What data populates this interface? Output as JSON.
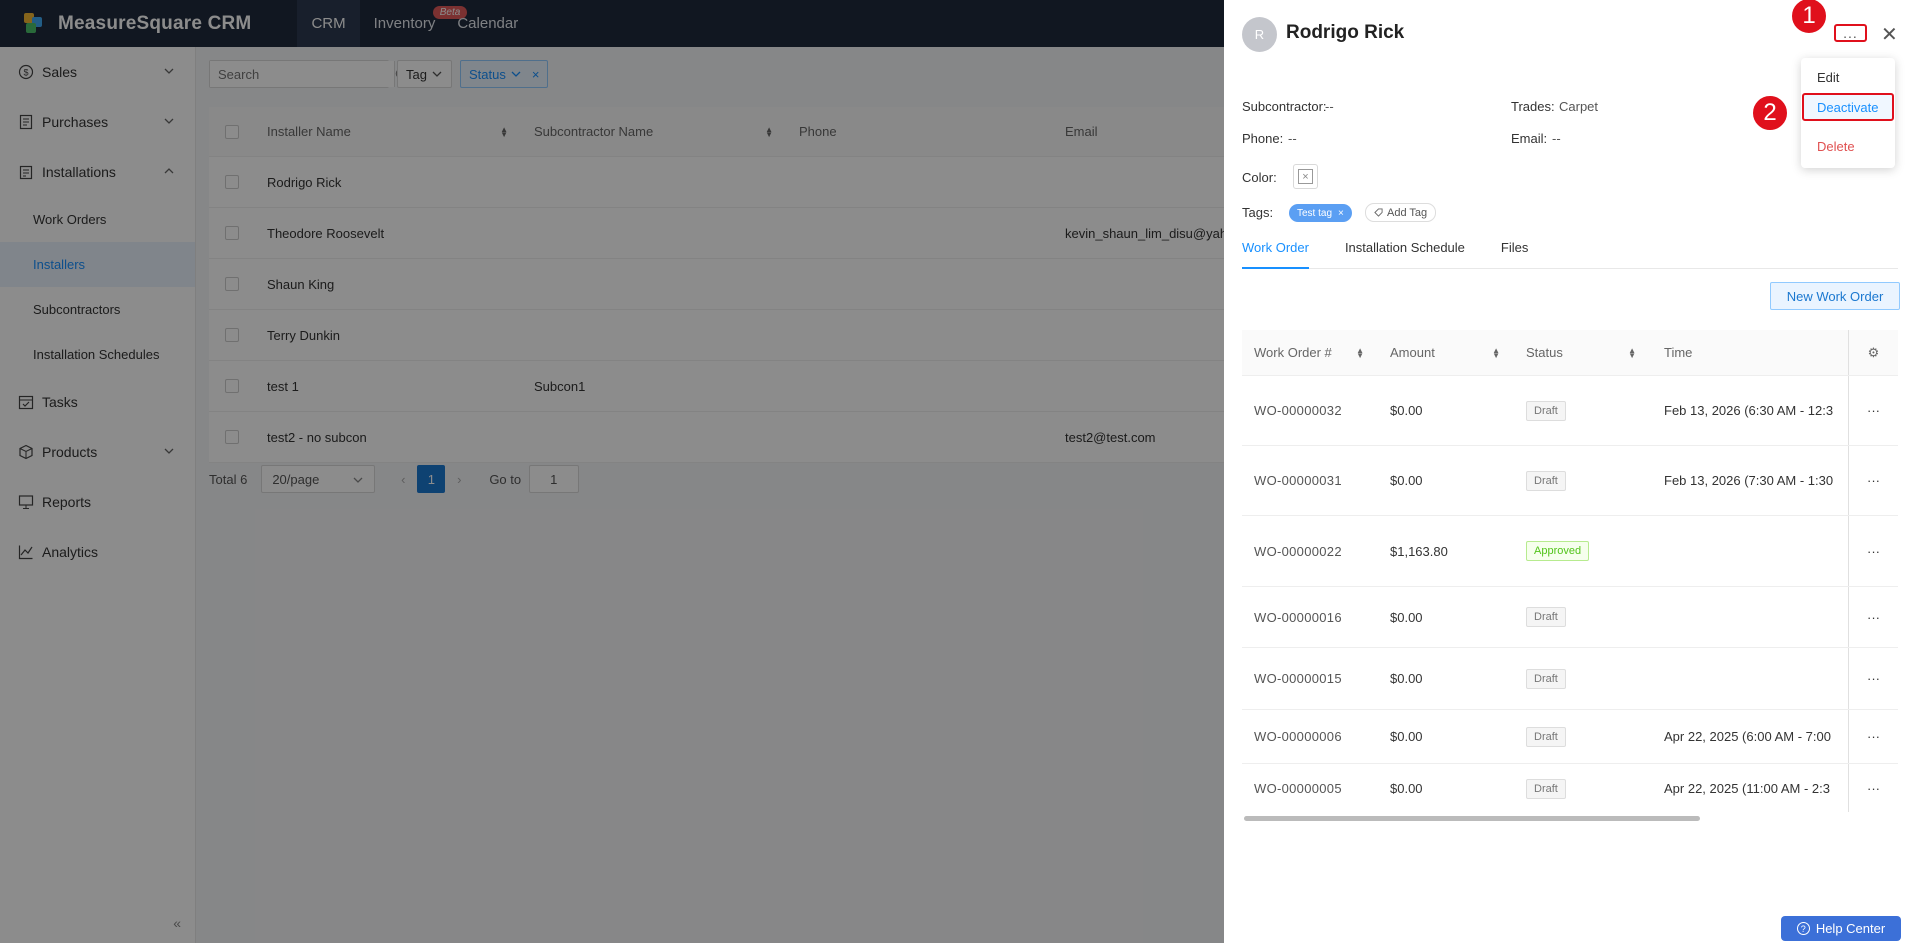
{
  "app": {
    "title": "MeasureSquare CRM",
    "brand_colors": {
      "topbar": "#1f2a3d",
      "accent": "#1890ff",
      "annotation": "#e0101c"
    }
  },
  "topnav": [
    {
      "label": "CRM",
      "active": true
    },
    {
      "label": "Inventory",
      "badge": "Beta"
    },
    {
      "label": "Calendar"
    }
  ],
  "sidebar": {
    "groups": [
      {
        "label": "Sales",
        "icon": "dollar-circle-icon",
        "expanded": false
      },
      {
        "label": "Purchases",
        "icon": "invoice-icon",
        "expanded": false
      },
      {
        "label": "Installations",
        "icon": "clipboard-icon",
        "expanded": true,
        "items": [
          {
            "label": "Work Orders"
          },
          {
            "label": "Installers",
            "active": true
          },
          {
            "label": "Subcontractors"
          },
          {
            "label": "Installation Schedules"
          }
        ]
      },
      {
        "label": "Tasks",
        "icon": "calendar-check-icon"
      },
      {
        "label": "Products",
        "icon": "cube-icon",
        "expanded": false
      },
      {
        "label": "Reports",
        "icon": "presentation-icon"
      },
      {
        "label": "Analytics",
        "icon": "line-chart-icon"
      }
    ]
  },
  "filters": {
    "search_placeholder": "Search",
    "tag_label": "Tag",
    "status_label": "Status"
  },
  "table": {
    "columns": [
      "Installer Name",
      "Subcontractor Name",
      "Phone",
      "Email"
    ],
    "rows": [
      {
        "name": "Rodrigo Rick",
        "sub": "",
        "phone": "",
        "email": ""
      },
      {
        "name": "Theodore Roosevelt",
        "sub": "",
        "phone": "",
        "email": "kevin_shaun_lim_disu@yah"
      },
      {
        "name": "Shaun King",
        "sub": "",
        "phone": "",
        "email": ""
      },
      {
        "name": "Terry Dunkin",
        "sub": "",
        "phone": "",
        "email": ""
      },
      {
        "name": "test 1",
        "sub": "Subcon1",
        "phone": "",
        "email": ""
      },
      {
        "name": "test2 - no subcon",
        "sub": "",
        "phone": "",
        "email": "test2@test.com"
      }
    ]
  },
  "pagination": {
    "total": "Total 6",
    "page_size": "20/page",
    "current_page": "1",
    "goto_label": "Go to",
    "goto_value": "1"
  },
  "drawer": {
    "avatar_letter": "R",
    "title": "Rodrigo Rick",
    "more_label": "...",
    "fields": {
      "subcontractor_label": "Subcontractor:",
      "subcontractor_value": "--",
      "trades_label": "Trades:",
      "trades_value": "Carpet",
      "phone_label": "Phone:",
      "phone_value": "--",
      "email_label": "Email:",
      "email_value": "--",
      "color_label": "Color:",
      "tags_label": "Tags:",
      "tag": "Test tag",
      "add_tag": "Add Tag"
    },
    "tabs": [
      {
        "label": "Work Order",
        "active": true
      },
      {
        "label": "Installation Schedule"
      },
      {
        "label": "Files"
      }
    ],
    "new_work_order": "New Work Order",
    "wo_columns": [
      "Work Order #",
      "Amount",
      "Status",
      "Time"
    ],
    "work_orders": [
      {
        "id": "WO-00000032",
        "amount": "$0.00",
        "status": "Draft",
        "time": "Feb 13, 2026 (6:30 AM - 12:3"
      },
      {
        "id": "WO-00000031",
        "amount": "$0.00",
        "status": "Draft",
        "time": "Feb 13, 2026 (7:30 AM - 1:30"
      },
      {
        "id": "WO-00000022",
        "amount": "$1,163.80",
        "status": "Approved",
        "time": ""
      },
      {
        "id": "WO-00000016",
        "amount": "$0.00",
        "status": "Draft",
        "time": ""
      },
      {
        "id": "WO-00000015",
        "amount": "$0.00",
        "status": "Draft",
        "time": ""
      },
      {
        "id": "WO-00000006",
        "amount": "$0.00",
        "status": "Draft",
        "time": "Apr 22, 2025 (6:00 AM - 7:00"
      },
      {
        "id": "WO-00000005",
        "amount": "$0.00",
        "status": "Draft",
        "time": "Apr 22, 2025 (11:00 AM - 2:3"
      }
    ],
    "help_center": "Help Center"
  },
  "menu": {
    "items": [
      {
        "label": "Edit"
      },
      {
        "label": "Deactivate",
        "highlighted": true
      },
      {
        "label": "Delete",
        "danger": true
      }
    ]
  },
  "annotations": {
    "step1": "1",
    "step2": "2"
  }
}
